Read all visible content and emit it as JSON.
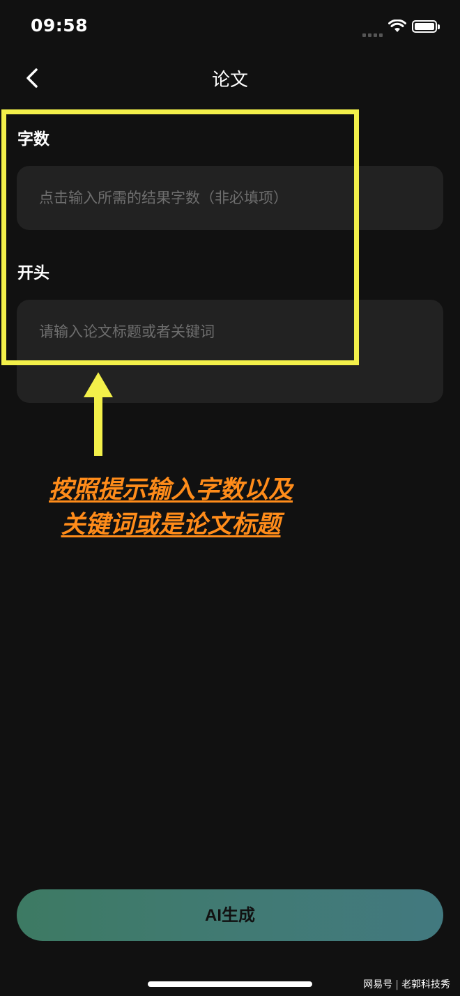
{
  "status": {
    "time": "09:58"
  },
  "nav": {
    "title": "论文"
  },
  "form": {
    "word_count_label": "字数",
    "word_count_placeholder": "点击输入所需的结果字数（非必填项）",
    "opening_label": "开头",
    "opening_placeholder": "请输入论文标题或者关键词"
  },
  "annotation": {
    "line1": "按照提示输入字数以及",
    "line2": "关键词或是论文标题",
    "color": "#ff8c1a",
    "box_color": "#f3f04a"
  },
  "action": {
    "generate_label": "AI生成"
  },
  "watermark": {
    "source": "网易号",
    "author": "老郭科技秀"
  }
}
